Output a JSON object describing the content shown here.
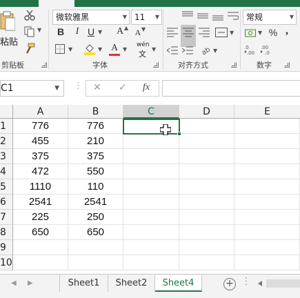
{
  "ribbon": {
    "clipboard": {
      "paste_label": "粘贴",
      "group_label": "剪贴板"
    },
    "font": {
      "font_name": "微软雅黑",
      "font_size": "11",
      "bold": "B",
      "italic": "I",
      "underline": "U",
      "grow": "A",
      "shrink": "A",
      "font_color": "A",
      "wen": "wén",
      "wen_char": "文",
      "group_label": "字体"
    },
    "alignment": {
      "group_label": "对齐方式"
    },
    "number": {
      "format": "常规",
      "percent": "%",
      "comma": ",",
      "group_label": "数字"
    }
  },
  "formula_bar": {
    "name_box": "C1",
    "cancel": "✕",
    "enter": "✓",
    "fx": "fx",
    "value": ""
  },
  "grid": {
    "columns": [
      "A",
      "B",
      "C",
      "D",
      "E"
    ],
    "selected_column": "C",
    "rows": [
      {
        "n": "1",
        "a": "776",
        "b": "776"
      },
      {
        "n": "2",
        "a": "455",
        "b": "210"
      },
      {
        "n": "3",
        "a": "375",
        "b": "375"
      },
      {
        "n": "4",
        "a": "472",
        "b": "550"
      },
      {
        "n": "5",
        "a": "1110",
        "b": "110"
      },
      {
        "n": "6",
        "a": "2541",
        "b": "2541"
      },
      {
        "n": "7",
        "a": "225",
        "b": "250"
      },
      {
        "n": "8",
        "a": "650",
        "b": "650"
      },
      {
        "n": "9",
        "a": "",
        "b": ""
      },
      {
        "n": "10",
        "a": "",
        "b": ""
      }
    ],
    "active_cell": "C1"
  },
  "sheets": {
    "tabs": [
      "Sheet1",
      "Sheet2",
      "Sheet4"
    ],
    "active": "Sheet4",
    "add_label": "+",
    "more": "⋮"
  },
  "colors": {
    "accent": "#217346",
    "ribbon_bg": "#f3f3f3"
  }
}
